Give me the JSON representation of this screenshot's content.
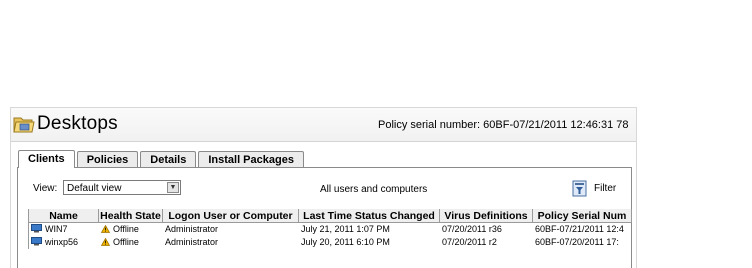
{
  "header": {
    "title": "Desktops",
    "policy_serial": "Policy serial number: 60BF-07/21/2011 12:46:31 78"
  },
  "tabs": [
    {
      "label": "Clients",
      "active": true
    },
    {
      "label": "Policies",
      "active": false
    },
    {
      "label": "Details",
      "active": false
    },
    {
      "label": "Install Packages",
      "active": false
    }
  ],
  "toolbar": {
    "view_label": "View:",
    "view_value": "Default view",
    "scope_text": "All users and computers",
    "filter_label": "Filter"
  },
  "table": {
    "columns": [
      "Name",
      "Health State",
      "Logon User or Computer",
      "Last Time Status Changed",
      "Virus Definitions",
      "Policy Serial Num"
    ],
    "rows": [
      {
        "name": "WIN7",
        "health": "Offline",
        "logon": "Administrator",
        "last_changed": "July 21, 2011 1:07 PM",
        "virus_defs": "07/20/2011 r36",
        "policy_serial": "60BF-07/21/2011 12:4"
      },
      {
        "name": "winxp56",
        "health": "Offline",
        "logon": "Administrator",
        "last_changed": "July 20, 2011 6:10 PM",
        "virus_defs": "07/20/2011 r2",
        "policy_serial": "60BF-07/20/2011 17:"
      }
    ]
  },
  "icons": {
    "folder": "folder-icon",
    "computer": "computer-icon",
    "warning": "warning-icon",
    "filter": "filter-icon",
    "dropdown": "chevron-down-icon"
  },
  "colors": {
    "warning": "#f0b400",
    "folder": "#e8c25a",
    "computer": "#3a78c8"
  }
}
